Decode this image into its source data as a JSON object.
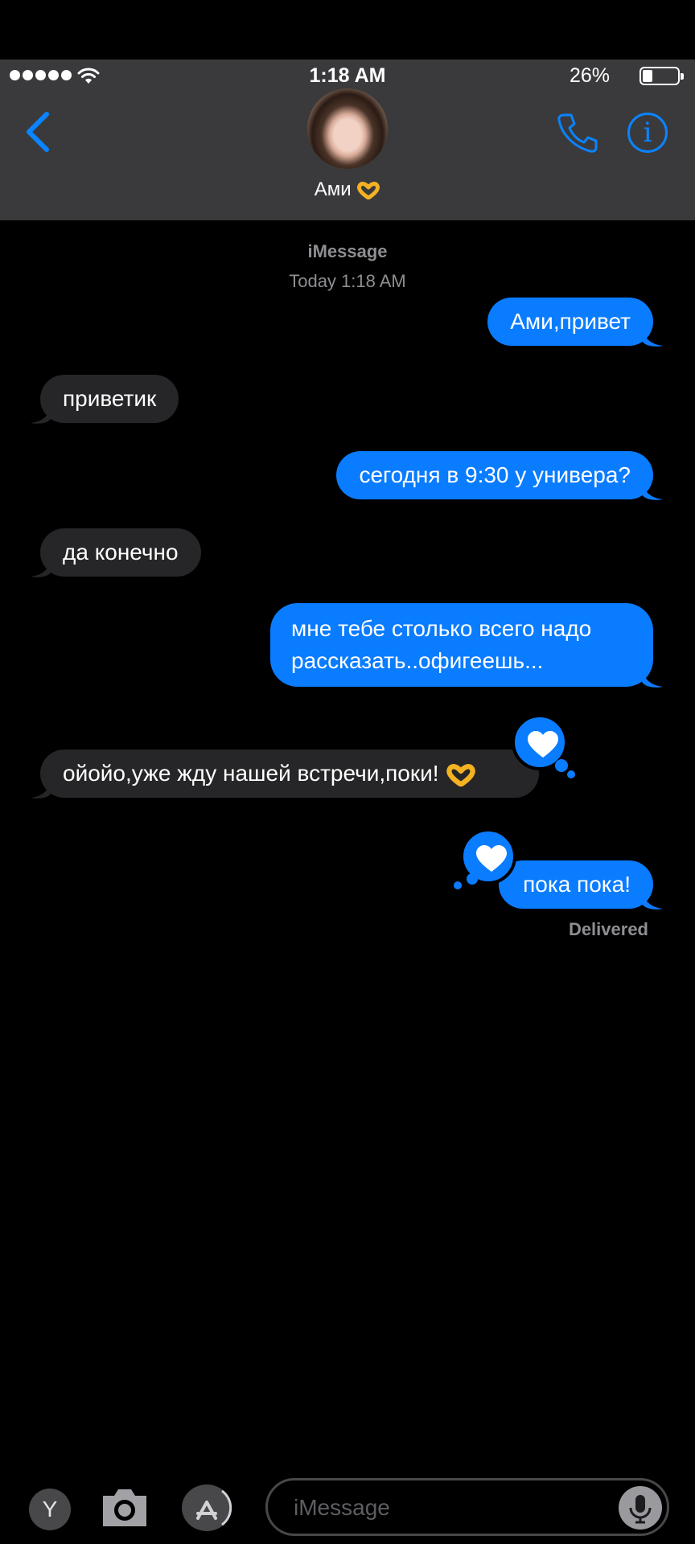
{
  "status_bar": {
    "time": "1:18 AM",
    "battery": "26%"
  },
  "contact": {
    "name": "Ами"
  },
  "thread": {
    "service": "iMessage",
    "timestamp": "Today 1:18 AM"
  },
  "messages": [
    {
      "text": "Ами,привет",
      "direction": "outgoing"
    },
    {
      "text": "приветик",
      "direction": "incoming"
    },
    {
      "text": "сегодня в 9:30 у универа?",
      "direction": "outgoing"
    },
    {
      "text": "да конечно",
      "direction": "incoming"
    },
    {
      "line1": "мне тебе столько всего надо",
      "line2": "рассказать..офигеешь...",
      "direction": "outgoing"
    },
    {
      "text": "ойойо,уже жду нашей встречи,поки!",
      "direction": "incoming",
      "tapback": "heart-icon"
    },
    {
      "text": "пока пока!",
      "direction": "outgoing",
      "tapback": "heart-icon"
    }
  ],
  "delivered": "Delivered",
  "compose": {
    "apps_button": "Y",
    "placeholder": "iMessage"
  },
  "colors": {
    "outgoing_bubble": "#0a7cff",
    "incoming_bubble": "#262628",
    "accent": "#0a84ff",
    "header": "#3a3a3c"
  }
}
